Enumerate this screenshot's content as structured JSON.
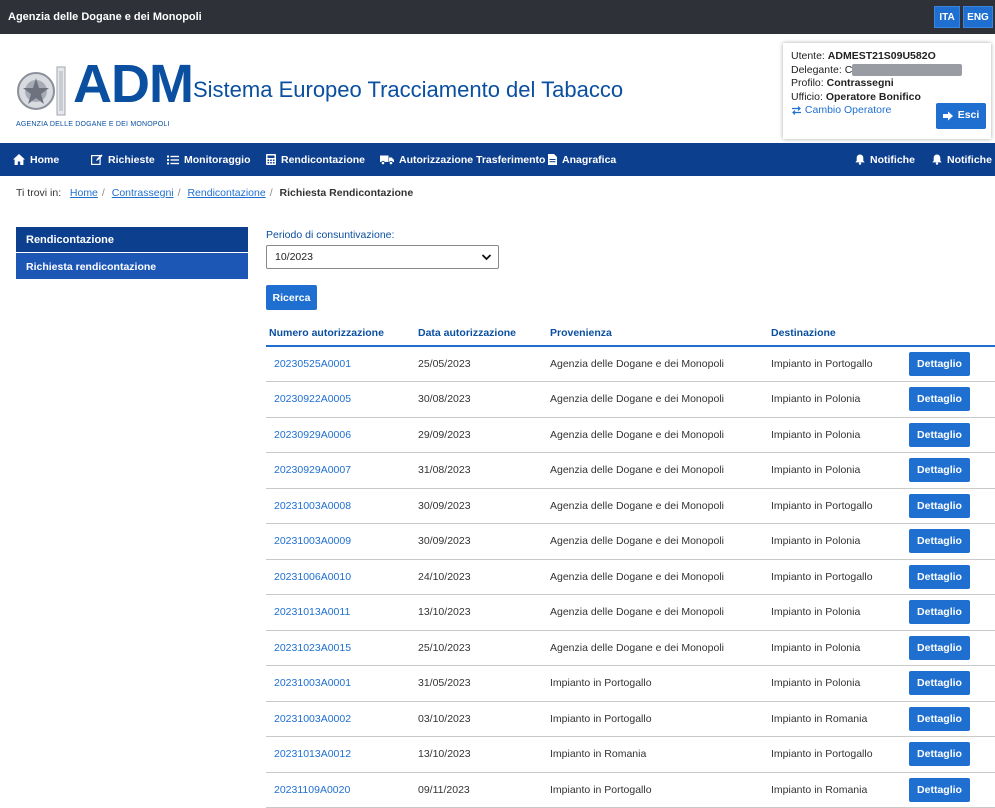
{
  "topbar": {
    "title": "Agenzia delle Dogane e dei Monopoli",
    "lang_ita": "ITA",
    "lang_eng": "ENG"
  },
  "header": {
    "logo_text": "ADM",
    "logo_sub": "AGENZIA DELLE DOGANE E DEI MONOPOLI",
    "app_title": "Sistema Europeo Tracciamento del Tabacco"
  },
  "user": {
    "utente_label": "Utente:",
    "utente_value": "ADMEST21S09U582O",
    "delegante_label": "Delegante:",
    "delegante_value": "C",
    "profilo_label": "Profilo:",
    "profilo_value": "Contrassegni",
    "ufficio_label": "Ufficio:",
    "ufficio_value": "Operatore Bonifico",
    "cambio": "Cambio Operatore",
    "esci": "Esci"
  },
  "nav": {
    "home": "Home",
    "richieste": "Richieste",
    "monitoraggio": "Monitoraggio",
    "rendicontazione": "Rendicontazione",
    "autorizzazione": "Autorizzazione Trasferimento",
    "anagrafica": "Anagrafica",
    "notifiche1": "Notifiche",
    "notifiche2": "Notifiche"
  },
  "breadcrumb": {
    "prefix": "Ti trovi in:",
    "home": "Home",
    "contrassegni": "Contrassegni",
    "rendicontazione": "Rendicontazione",
    "current": "Richiesta Rendicontazione"
  },
  "sidebar": {
    "title": "Rendicontazione",
    "item": "Richiesta rendicontazione"
  },
  "form": {
    "period_label": "Periodo di consuntivazione:",
    "period_value": "10/2023",
    "search_button": "Ricerca"
  },
  "table": {
    "headers": [
      "Numero autorizzazione",
      "Data autorizzazione",
      "Provenienza",
      "Destinazione"
    ],
    "detail_label": "Dettaglio",
    "rows": [
      [
        "20230525A0001",
        "25/05/2023",
        "Agenzia delle Dogane e dei Monopoli",
        "Impianto in Portogallo"
      ],
      [
        "20230922A0005",
        "30/08/2023",
        "Agenzia delle Dogane e dei Monopoli",
        "Impianto in Polonia"
      ],
      [
        "20230929A0006",
        "29/09/2023",
        "Agenzia delle Dogane e dei Monopoli",
        "Impianto in Polonia"
      ],
      [
        "20230929A0007",
        "31/08/2023",
        "Agenzia delle Dogane e dei Monopoli",
        "Impianto in Polonia"
      ],
      [
        "20231003A0008",
        "30/09/2023",
        "Agenzia delle Dogane e dei Monopoli",
        "Impianto in Portogallo"
      ],
      [
        "20231003A0009",
        "30/09/2023",
        "Agenzia delle Dogane e dei Monopoli",
        "Impianto in Polonia"
      ],
      [
        "20231006A0010",
        "24/10/2023",
        "Agenzia delle Dogane e dei Monopoli",
        "Impianto in Portogallo"
      ],
      [
        "20231013A0011",
        "13/10/2023",
        "Agenzia delle Dogane e dei Monopoli",
        "Impianto in Polonia"
      ],
      [
        "20231023A0015",
        "25/10/2023",
        "Agenzia delle Dogane e dei Monopoli",
        "Impianto in Polonia"
      ],
      [
        "20231003A0001",
        "31/05/2023",
        "Impianto in Portogallo",
        "Impianto in Polonia"
      ],
      [
        "20231003A0002",
        "03/10/2023",
        "Impianto in Portogallo",
        "Impianto in Romania"
      ],
      [
        "20231013A0012",
        "13/10/2023",
        "Impianto in Romania",
        "Impianto in Portogallo"
      ],
      [
        "20231109A0020",
        "09/11/2023",
        "Impianto in Portogallo",
        "Impianto in Romania"
      ]
    ]
  }
}
